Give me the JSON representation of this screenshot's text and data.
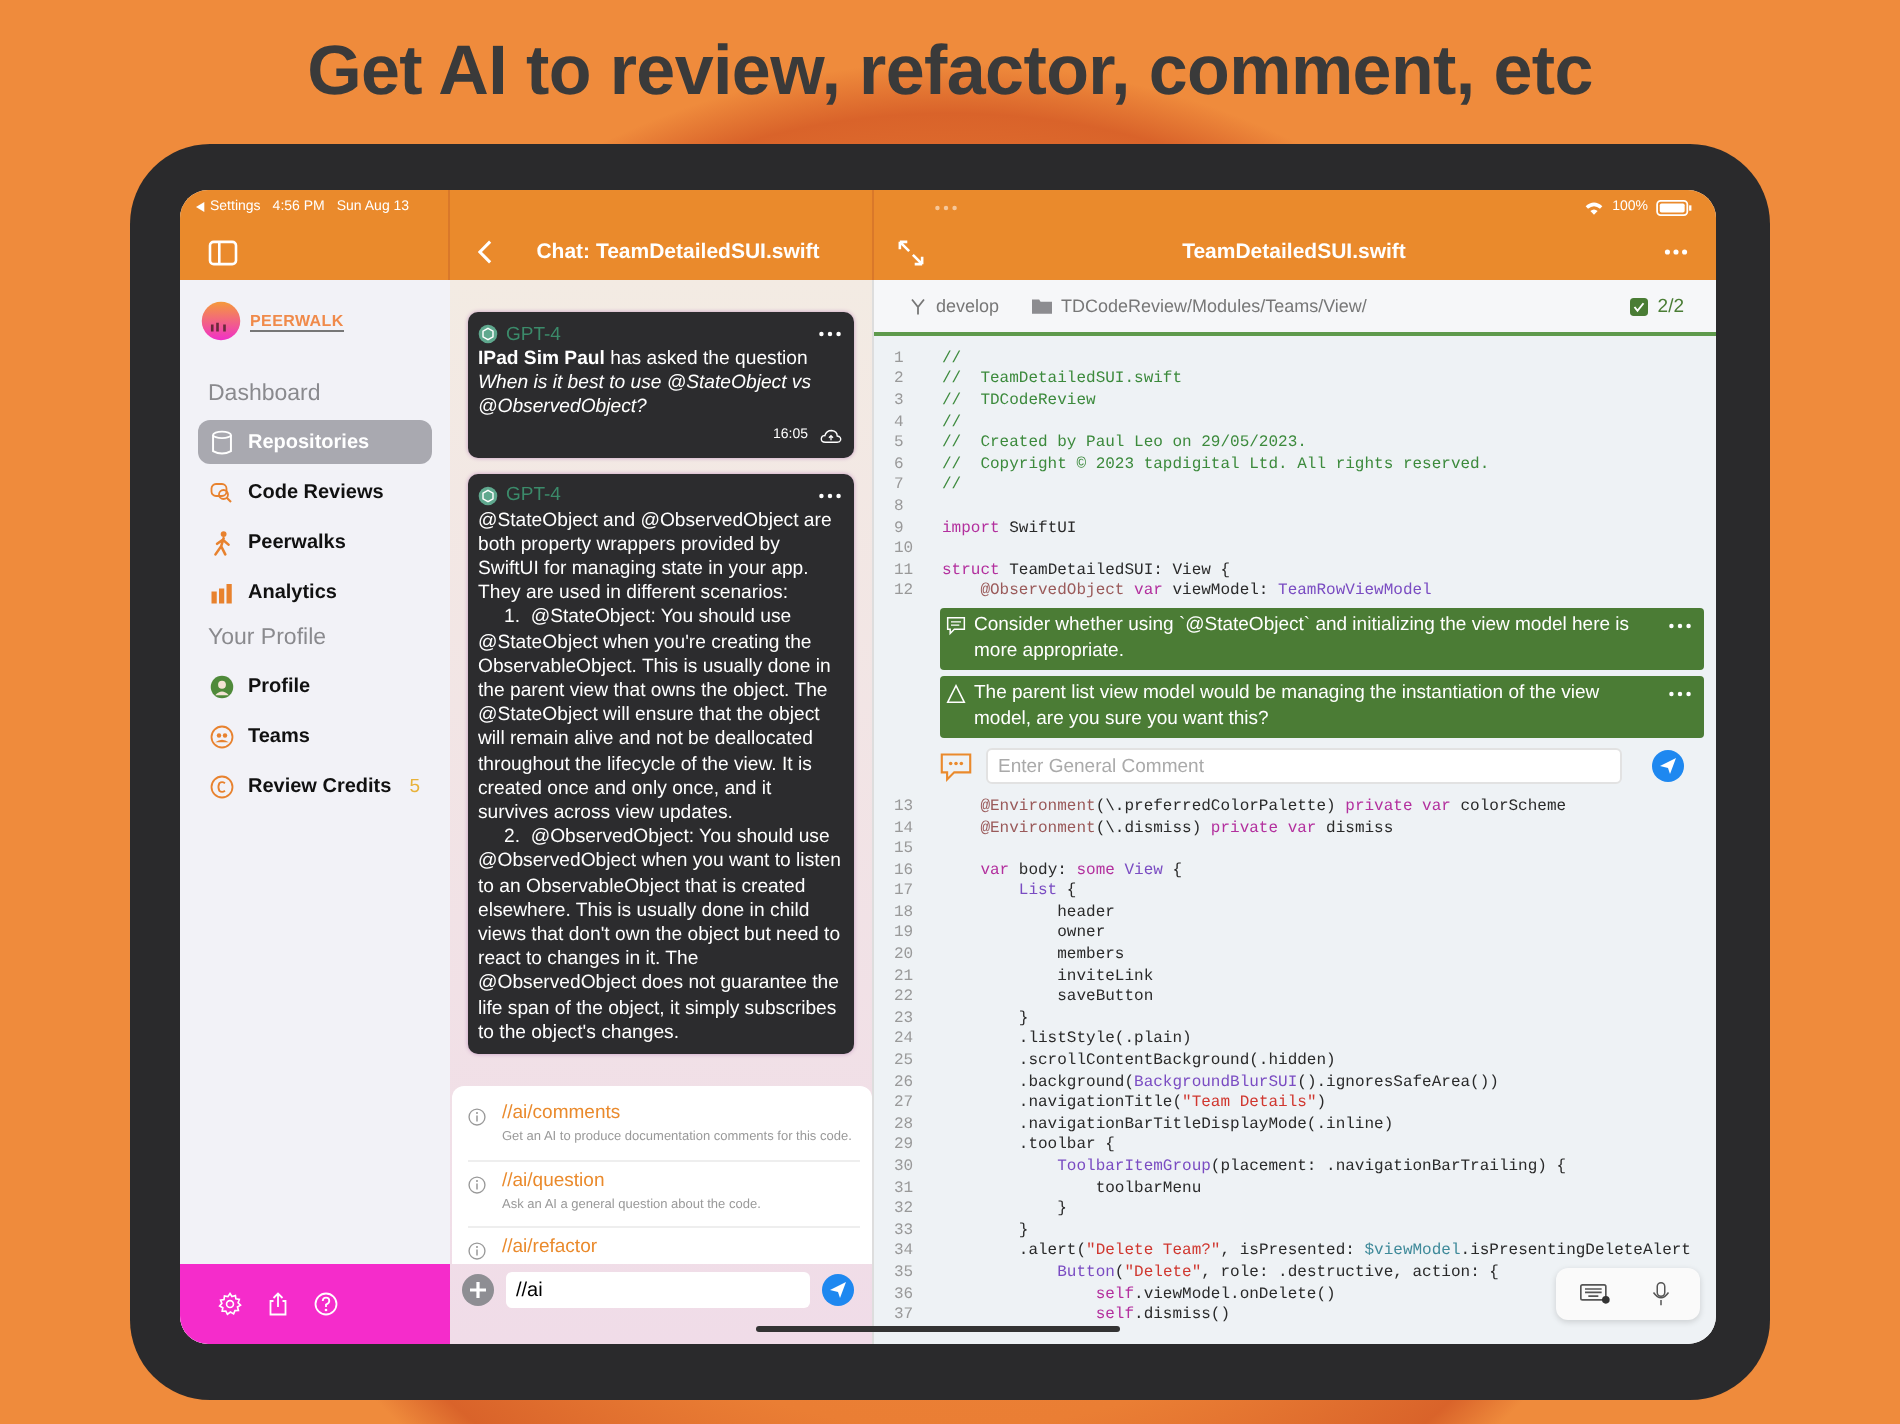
{
  "headline": "Get AI to review, refactor, comment, etc",
  "status_bar": {
    "back_label": "Settings",
    "time": "4:56 PM",
    "date": "Sun Aug 13",
    "battery": "100%"
  },
  "sidebar": {
    "logo": "PEERWALK",
    "sections": [
      {
        "title": "Dashboard",
        "items": [
          {
            "label": "Repositories",
            "selected": true
          },
          {
            "label": "Code Reviews",
            "selected": false
          },
          {
            "label": "Peerwalks",
            "selected": false
          },
          {
            "label": "Analytics",
            "selected": false
          }
        ]
      },
      {
        "title": "Your Profile",
        "items": [
          {
            "label": "Profile",
            "selected": false
          },
          {
            "label": "Teams",
            "selected": false
          },
          {
            "label": "Review Credits",
            "selected": false,
            "badge": "5"
          }
        ]
      }
    ]
  },
  "chat": {
    "title": "Chat: TeamDetailedSUI.swift",
    "messages": [
      {
        "sender": "GPT-4",
        "paragraphs": [
          "**IPad Sim Paul** has asked the question *When is it best to use @StateObject vs @ObservedObject?*"
        ],
        "time": "16:05"
      },
      {
        "sender": "GPT-4",
        "paragraphs": [
          "@StateObject and @ObservedObject are both property wrappers provided by SwiftUI for managing state in your app. They are used in different scenarios:"
        ],
        "list": [
          {
            "number": "1.",
            "text": "@StateObject: You should use @StateObject when you're creating the ObservableObject. This is usually done in the parent view that owns the object. The @StateObject will ensure that the object will remain alive and not be deallocated throughout the lifecycle of the view. It is created once and only once, and it survives across view updates."
          },
          {
            "number": "2.",
            "text": "@ObservedObject: You should use @ObservedObject when you want to listen to an ObservableObject that is created elsewhere. This is usually done in child views that don't own the object but need to react to changes in it. The @ObservedObject does not guarantee the life span of the object, it simply subscribes to the object's changes."
          }
        ]
      }
    ],
    "suggestions": [
      {
        "command": "//ai/comments",
        "description": "Get an AI to produce documentation comments for this code."
      },
      {
        "command": "//ai/question",
        "description": "Ask an AI a general question about the code."
      },
      {
        "command": "//ai/refactor"
      }
    ],
    "input": {
      "value": "//ai"
    }
  },
  "editor": {
    "title": "TeamDetailedSUI.swift",
    "branch": "develop",
    "path": "TDCodeReview/Modules/Teams/View/",
    "progress": "2/2",
    "progress_checked": true,
    "blocks": [
      {
        "kind": "code",
        "lines": [
          {
            "n": "1",
            "tokens": [
              {
                "kind": "comment",
                "text": "//"
              }
            ]
          },
          {
            "n": "2",
            "tokens": [
              {
                "kind": "comment",
                "text": "//  TeamDetailedSUI.swift"
              }
            ]
          },
          {
            "n": "3",
            "tokens": [
              {
                "kind": "comment",
                "text": "//  TDCodeReview"
              }
            ]
          },
          {
            "n": "4",
            "tokens": [
              {
                "kind": "comment",
                "text": "//"
              }
            ]
          },
          {
            "n": "5",
            "tokens": [
              {
                "kind": "comment",
                "text": "//  Created by Paul Leo on 29/05/2023."
              }
            ]
          },
          {
            "n": "6",
            "tokens": [
              {
                "kind": "comment",
                "text": "//  Copyright © 2023 tapdigital Ltd. All rights reserved."
              }
            ]
          },
          {
            "n": "7",
            "tokens": [
              {
                "kind": "comment",
                "text": "//"
              }
            ]
          },
          {
            "n": "8"
          },
          {
            "n": "9",
            "tokens": [
              {
                "kind": "keyword",
                "text": "import"
              },
              {
                "kind": "plain",
                "text": " SwiftUI"
              }
            ]
          },
          {
            "n": "10"
          },
          {
            "n": "11",
            "tokens": [
              {
                "kind": "keyword",
                "text": "struct"
              },
              {
                "kind": "plain",
                "text": " TeamDetailedSUI: View {"
              }
            ]
          },
          {
            "n": "12",
            "tokens": [
              {
                "kind": "attribute",
                "text": "    @ObservedObject"
              },
              {
                "kind": "keyword",
                "text": " var"
              },
              {
                "kind": "plain",
                "text": " viewModel: "
              },
              {
                "kind": "type",
                "text": "TeamRowViewModel"
              }
            ]
          }
        ]
      },
      {
        "kind": "review",
        "comments": [
          {
            "kind": "comment",
            "text": "Consider whether using `@StateObject` and initializing the view model here is more appropriate."
          },
          {
            "kind": "warning",
            "text": "The parent list view model would be managing the instantiation of the view model, are you sure you want this?"
          }
        ],
        "placeholder": "Enter General Comment"
      },
      {
        "kind": "code",
        "lines": [
          {
            "n": "13",
            "tokens": [
              {
                "kind": "attribute",
                "text": "    @Environment"
              },
              {
                "kind": "plain",
                "text": "(\\.preferredColorPalette) "
              },
              {
                "kind": "keyword",
                "text": "private var"
              },
              {
                "kind": "plain",
                "text": " colorScheme"
              }
            ]
          },
          {
            "n": "14",
            "tokens": [
              {
                "kind": "attribute",
                "text": "    @Environment"
              },
              {
                "kind": "plain",
                "text": "(\\.dismiss) "
              },
              {
                "kind": "keyword",
                "text": "private var"
              },
              {
                "kind": "plain",
                "text": " dismiss"
              }
            ]
          },
          {
            "n": "15"
          },
          {
            "n": "16",
            "tokens": [
              {
                "kind": "keyword",
                "text": "    var"
              },
              {
                "kind": "plain",
                "text": " body: "
              },
              {
                "kind": "keyword",
                "text": "some"
              },
              {
                "kind": "type",
                "text": " View"
              },
              {
                "kind": "plain",
                "text": " {"
              }
            ]
          },
          {
            "n": "17",
            "tokens": [
              {
                "kind": "type",
                "text": "        List"
              },
              {
                "kind": "plain",
                "text": " {"
              }
            ]
          },
          {
            "n": "18",
            "tokens": [
              {
                "kind": "plain",
                "text": "            header"
              }
            ]
          },
          {
            "n": "19",
            "tokens": [
              {
                "kind": "plain",
                "text": "            owner"
              }
            ]
          },
          {
            "n": "20",
            "tokens": [
              {
                "kind": "plain",
                "text": "            members"
              }
            ]
          },
          {
            "n": "21",
            "tokens": [
              {
                "kind": "plain",
                "text": "            inviteLink"
              }
            ]
          },
          {
            "n": "22",
            "tokens": [
              {
                "kind": "plain",
                "text": "            saveButton"
              }
            ]
          },
          {
            "n": "23",
            "tokens": [
              {
                "kind": "plain",
                "text": "        }"
              }
            ]
          },
          {
            "n": "24",
            "tokens": [
              {
                "kind": "plain",
                "text": "        .listStyle(.plain)"
              }
            ]
          },
          {
            "n": "25",
            "tokens": [
              {
                "kind": "plain",
                "text": "        .scrollContentBackground(.hidden)"
              }
            ]
          },
          {
            "n": "26",
            "tokens": [
              {
                "kind": "plain",
                "text": "        .background("
              },
              {
                "kind": "type",
                "text": "BackgroundBlurSUI"
              },
              {
                "kind": "plain",
                "text": "().ignoresSafeArea())"
              }
            ]
          },
          {
            "n": "27",
            "tokens": [
              {
                "kind": "plain",
                "text": "        .navigationTitle("
              },
              {
                "kind": "string",
                "text": "\"Team Details\""
              },
              {
                "kind": "plain",
                "text": ")"
              }
            ]
          },
          {
            "n": "28",
            "tokens": [
              {
                "kind": "plain",
                "text": "        .navigationBarTitleDisplayMode(.inline)"
              }
            ]
          },
          {
            "n": "29",
            "tokens": [
              {
                "kind": "plain",
                "text": "        .toolbar {"
              }
            ]
          },
          {
            "n": "30",
            "tokens": [
              {
                "kind": "type",
                "text": "            ToolbarItemGroup"
              },
              {
                "kind": "plain",
                "text": "(placement: .navigationBarTrailing) {"
              }
            ]
          },
          {
            "n": "31",
            "tokens": [
              {
                "kind": "plain",
                "text": "                toolbarMenu"
              }
            ]
          },
          {
            "n": "32",
            "tokens": [
              {
                "kind": "plain",
                "text": "            }"
              }
            ]
          },
          {
            "n": "33",
            "tokens": [
              {
                "kind": "plain",
                "text": "        }"
              }
            ]
          },
          {
            "n": "34",
            "tokens": [
              {
                "kind": "plain",
                "text": "        .alert("
              },
              {
                "kind": "string",
                "text": "\"Delete Team?\""
              },
              {
                "kind": "plain",
                "text": ", isPresented: "
              },
              {
                "kind": "variable",
                "text": "$viewModel"
              },
              {
                "kind": "plain",
                "text": ".isPresentingDeleteAlert"
              }
            ]
          },
          {
            "n": "35",
            "tokens": [
              {
                "kind": "type",
                "text": "            Button"
              },
              {
                "kind": "plain",
                "text": "("
              },
              {
                "kind": "string",
                "text": "\"Delete\""
              },
              {
                "kind": "plain",
                "text": ", role: .destructive, action: {"
              }
            ]
          },
          {
            "n": "36",
            "tokens": [
              {
                "kind": "keyword",
                "text": "                self"
              },
              {
                "kind": "plain",
                "text": ".viewModel.onDelete()"
              }
            ]
          },
          {
            "n": "37",
            "tokens": [
              {
                "kind": "keyword",
                "text": "                self"
              },
              {
                "kind": "plain",
                "text": ".dismiss()"
              }
            ]
          }
        ]
      }
    ]
  }
}
